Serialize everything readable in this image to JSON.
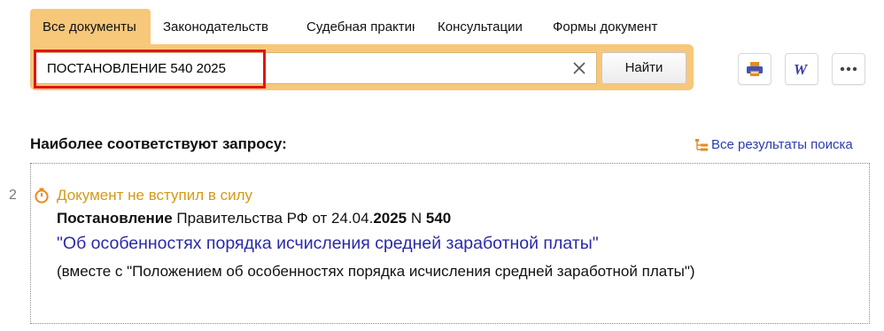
{
  "tabs": [
    {
      "label": "Все документы",
      "active": true
    },
    {
      "label": "Законодательств",
      "active": false
    },
    {
      "label": "Судебная практик",
      "active": false
    },
    {
      "label": "Консультации",
      "active": false
    },
    {
      "label": "Формы документ",
      "active": false
    }
  ],
  "search": {
    "value": "ПОСТАНОВЛЕНИЕ 540 2025",
    "find_label": "Найти"
  },
  "toolbar": {
    "print_icon": "printer-icon",
    "word_icon": "word-export-icon",
    "word_glyph": "W",
    "more_icon": "more-dots-icon"
  },
  "results": {
    "heading": "Наиболее соответствуют запросу:",
    "all_results_label": "Все результаты поиска",
    "items": [
      {
        "number": "2",
        "status": "Документ не вступил в силу",
        "doc_type": "Постановление",
        "doc_issuer": " Правительства РФ от 24.04.",
        "doc_year": "2025",
        "doc_n": " N ",
        "doc_number": "540",
        "title": "\"Об особенностях порядка исчисления средней заработной платы\"",
        "note": "(вместе с \"Положением об особенностях порядка исчисления средней заработной платы\")"
      }
    ]
  },
  "colors": {
    "accent": "#f7c77a",
    "link": "#2a2aa8",
    "status": "#d39a1a",
    "highlight": "#e11414"
  }
}
